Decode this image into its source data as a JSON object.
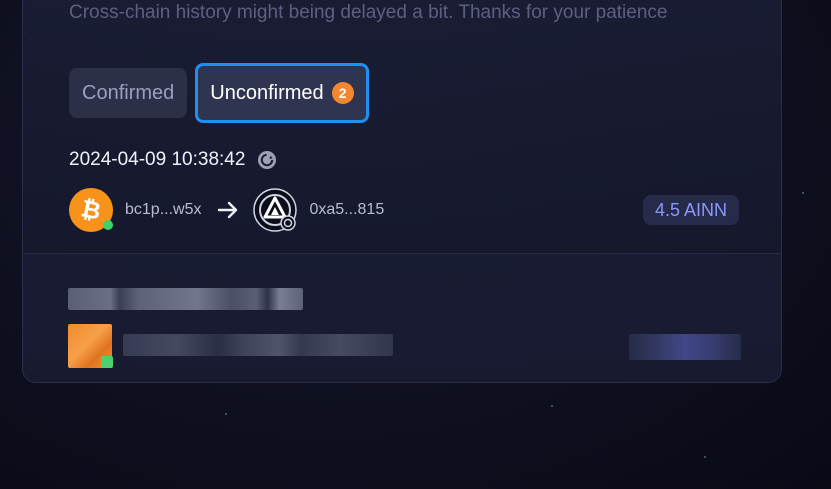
{
  "notice": {
    "text": "Cross-chain history might being delayed a bit. Thanks for your patience"
  },
  "tabs": [
    {
      "label": "Confirmed",
      "active": false
    },
    {
      "label": "Unconfirmed",
      "active": true,
      "count": "2"
    }
  ],
  "transactions": [
    {
      "time": "2024-04-09 10:38:42",
      "status_icon": "pending-icon",
      "from": {
        "coin_icon": "bitcoin-icon",
        "address": "bc1p...w5x"
      },
      "to": {
        "coin_icon": "ainn-icon",
        "address": "0xa5...815"
      },
      "amount": "4.5 AINN"
    }
  ],
  "colors": {
    "accent": "#1f8ff0",
    "badge": "#f4862f",
    "bitcoin": "#f7931a",
    "amount_text": "#8b97ff"
  }
}
